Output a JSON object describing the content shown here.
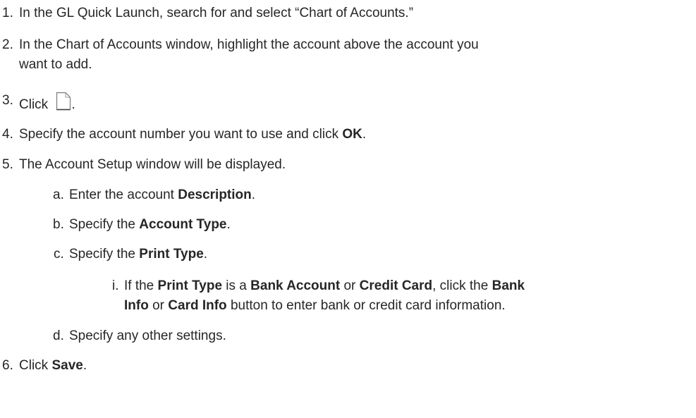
{
  "steps": [
    {
      "num": "1.",
      "lines": [
        [
          {
            "t": "In the GL Quick Launch, search for and select “Chart of Accounts.”"
          }
        ]
      ]
    },
    {
      "num": "2.",
      "lines": [
        [
          {
            "t": "In the Chart of Accounts window, highlight the account above the account you"
          }
        ],
        [
          {
            "t": "want to add."
          }
        ]
      ]
    },
    {
      "num": "3.",
      "lines": [
        [
          {
            "t": "Click "
          },
          {
            "icon": "new-document-icon"
          },
          {
            "t": "."
          }
        ]
      ]
    },
    {
      "num": "4.",
      "lines": [
        [
          {
            "t": "Specify the account number you want to use and click "
          },
          {
            "t": "OK",
            "b": true
          },
          {
            "t": "."
          }
        ]
      ]
    },
    {
      "num": "5.",
      "lines": [
        [
          {
            "t": "The Account Setup window will be displayed."
          }
        ]
      ]
    },
    {
      "num": "a.",
      "lines": [
        [
          {
            "t": "Enter the account "
          },
          {
            "t": "Description",
            "b": true
          },
          {
            "t": "."
          }
        ]
      ]
    },
    {
      "num": "b.",
      "lines": [
        [
          {
            "t": "Specify the "
          },
          {
            "t": "Account Type",
            "b": true
          },
          {
            "t": "."
          }
        ]
      ]
    },
    {
      "num": "c.",
      "lines": [
        [
          {
            "t": "Specify the "
          },
          {
            "t": "Print Type",
            "b": true
          },
          {
            "t": "."
          }
        ]
      ]
    },
    {
      "num": "i.",
      "lines": [
        [
          {
            "t": "If the "
          },
          {
            "t": "Print Type",
            "b": true
          },
          {
            "t": " is a "
          },
          {
            "t": "Bank Account",
            "b": true
          },
          {
            "t": " or "
          },
          {
            "t": "Credit Card",
            "b": true
          },
          {
            "t": ", click the "
          },
          {
            "t": "Bank",
            "b": true
          }
        ],
        [
          {
            "t": "Info",
            "b": true
          },
          {
            "t": " or "
          },
          {
            "t": "Card Info",
            "b": true
          },
          {
            "t": " button to enter bank or credit card information."
          }
        ]
      ]
    },
    {
      "num": "d.",
      "lines": [
        [
          {
            "t": "Specify any other settings."
          }
        ]
      ]
    },
    {
      "num": "6.",
      "lines": [
        [
          {
            "t": "Click "
          },
          {
            "t": "Save",
            "b": true
          },
          {
            "t": "."
          }
        ]
      ]
    }
  ]
}
